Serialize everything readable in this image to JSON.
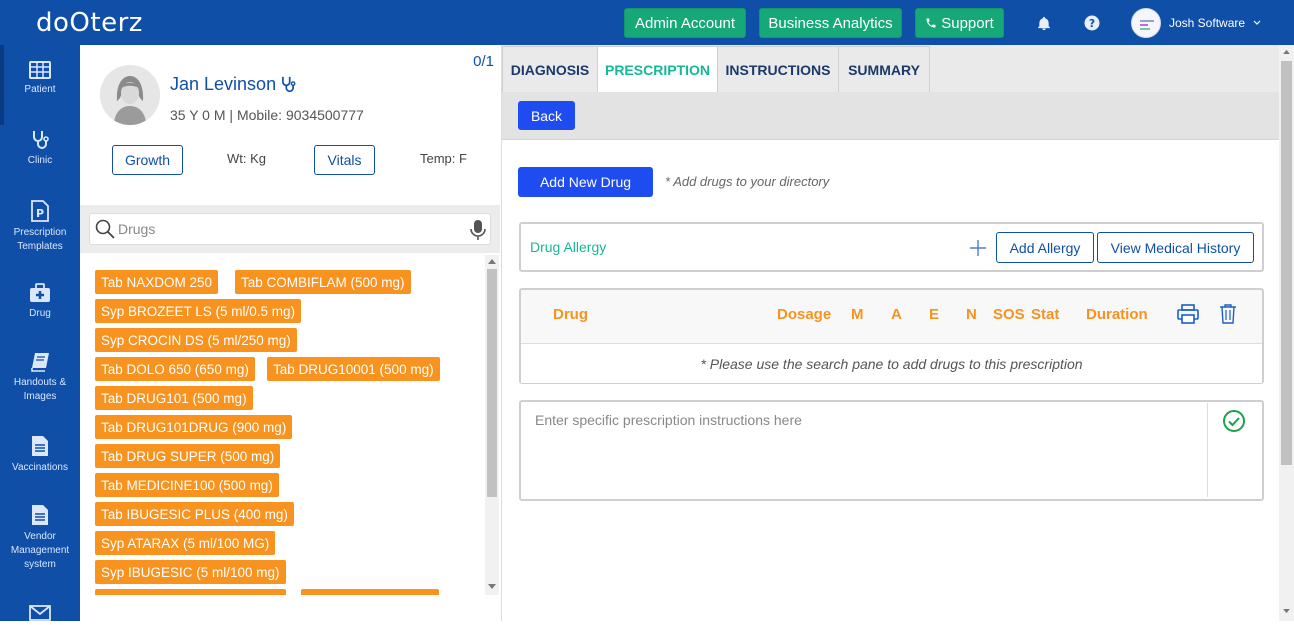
{
  "app": {
    "logo": "doOterz"
  },
  "topbar": {
    "admin_label": "Admin Account",
    "analytics_label": "Business Analytics",
    "support_label": "Support",
    "user_name": "Josh Software",
    "brand_color": "#0f4fa8",
    "button_color": "#16a977"
  },
  "sidenav": {
    "items": [
      {
        "label": "Patient",
        "icon": "grid-table-icon"
      },
      {
        "label": "Clinic",
        "icon": "stethoscope-icon"
      },
      {
        "label": "Prescription Templates",
        "icon": "prescription-doc-icon"
      },
      {
        "label": "Drug",
        "icon": "first-aid-kit-icon"
      },
      {
        "label": "Handouts & Images",
        "icon": "book-icon"
      },
      {
        "label": "Vaccinations",
        "icon": "document-icon"
      },
      {
        "label": "Vendor Management system",
        "icon": "document-icon"
      },
      {
        "label": "",
        "icon": "mail-icon"
      }
    ]
  },
  "patient": {
    "name": "Jan Levinson",
    "meta": "35 Y 0 M | Mobile: 9034500777",
    "count": "0/1",
    "growth_label": "Growth",
    "weight": "Wt: Kg",
    "vitals_label": "Vitals",
    "temp": "Temp: F"
  },
  "search": {
    "placeholder": "Drugs"
  },
  "drugs": [
    "Tab NAXDOM 250",
    "Tab COMBIFLAM (500 mg)",
    "Syp BROZEET LS (5 ml/0.5 mg)",
    "Syp CROCIN DS (5 ml/250 mg)",
    "Tab DOLO 650 (650 mg)",
    "Tab DRUG10001 (500 mg)",
    "Tab DRUG101 (500 mg)",
    "Tab DRUG101DRUG (900 mg)",
    "Tab DRUG SUPER (500 mg)",
    "Tab MEDICINE100 (500 mg)",
    "Tab IBUGESIC PLUS (400 mg)",
    "Syp ATARAX (5 ml/100 MG)",
    "Syp IBUGESIC (5 ml/100 mg)"
  ],
  "tabs": [
    "DIAGNOSIS",
    "PRESCRIPTION",
    "INSTRUCTIONS",
    "SUMMARY"
  ],
  "active_tab": "PRESCRIPTION",
  "prescription": {
    "back_label": "Back",
    "add_drug_label": "Add New Drug",
    "add_drug_hint": "* Add drugs to your directory",
    "allergy_label": "Drug Allergy",
    "add_allergy_label": "Add Allergy",
    "view_history_label": "View Medical History",
    "columns": [
      "Drug",
      "Dosage",
      "M",
      "A",
      "E",
      "N",
      "SOS",
      "Stat",
      "Duration"
    ],
    "empty_message": "* Please use the search pane to add drugs to this prescription",
    "instructions_placeholder": "Enter specific prescription instructions here"
  }
}
